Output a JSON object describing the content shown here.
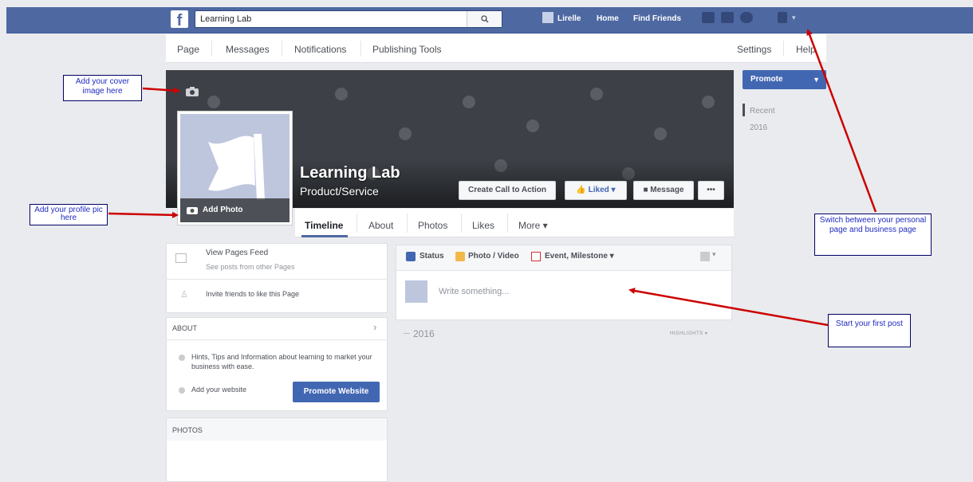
{
  "topbar": {
    "logo": "f",
    "search_value": "Learning Lab",
    "search_icon": "magnifier-icon",
    "user_name": "Lirelle",
    "home": "Home",
    "find_friends": "Find Friends"
  },
  "subnav": {
    "page": "Page",
    "messages": "Messages",
    "notifications": "Notifications",
    "publishing_tools": "Publishing Tools",
    "settings": "Settings",
    "help": "Help"
  },
  "cover": {
    "page_name": "Learning Lab",
    "category": "Product/Service",
    "add_photo": "Add Photo",
    "cta_button": "Create Call to Action",
    "liked_button": "Liked ▾",
    "message_button": "Message",
    "more_button": "•••"
  },
  "tabs": [
    "Timeline",
    "About",
    "Photos",
    "Likes",
    "More ▾"
  ],
  "right_column": {
    "promote": "Promote",
    "recent": "Recent",
    "year": "2016"
  },
  "feed_card": {
    "view_feed_title": "View Pages Feed",
    "view_feed_sub": "See posts from other Pages",
    "invite": "Invite friends to like this Page"
  },
  "about_card": {
    "header": "ABOUT",
    "description": "Hints, Tips and Information about learning to market your business with ease.",
    "add_website": "Add your website",
    "promote_website": "Promote Website"
  },
  "photos_card": {
    "header": "PHOTOS"
  },
  "composer": {
    "status": "Status",
    "photo_video": "Photo / Video",
    "event": "Event, Milestone ▾",
    "placeholder": "Write something..."
  },
  "timeline": {
    "year": "2016",
    "highlights": "HIGHLIGHTS ▾"
  },
  "annotations": {
    "cover": "Add your cover image here",
    "profile": "Add your profile pic here",
    "switch": "Switch between your personal page and business page",
    "post": "Start your first post"
  },
  "colors": {
    "fb_blue": "#4e69a2",
    "button_blue": "#4267b2",
    "arrow_red": "#cc0000"
  }
}
